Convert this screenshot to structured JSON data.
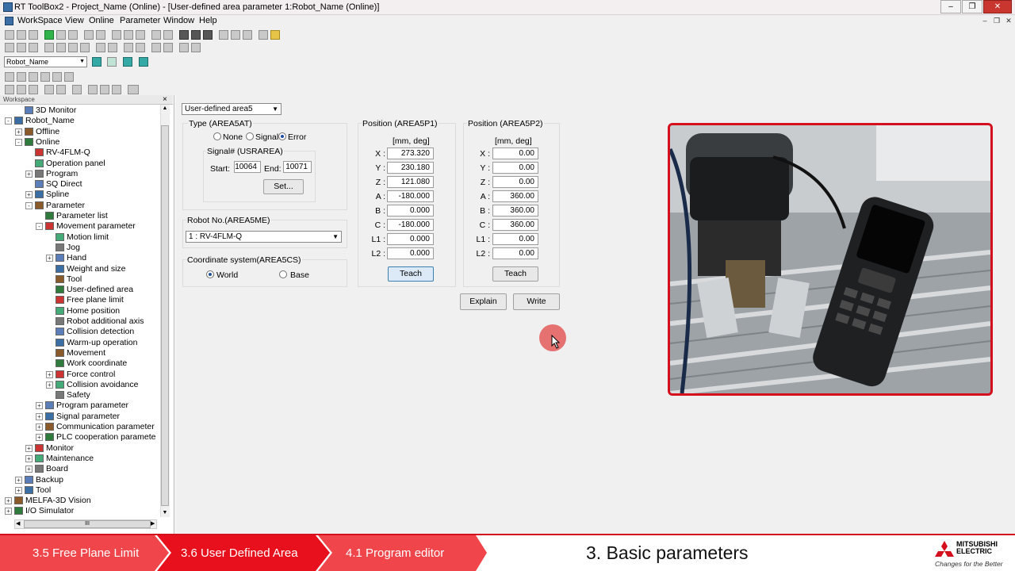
{
  "window": {
    "title": "RT ToolBox2 - Project_Name  (Online) - [User-defined area parameter 1:Robot_Name (Online)]",
    "controls": [
      "–",
      "❐",
      "✕"
    ]
  },
  "menu": [
    "WorkSpace",
    "View",
    "Online",
    "Parameter",
    "Window",
    "Help"
  ],
  "toolbar": {
    "robot_select": "Robot_Name"
  },
  "workspace": {
    "header": "Workspace",
    "tree": [
      {
        "label": "3D Monitor",
        "level": 2,
        "exp": ""
      },
      {
        "label": "Robot_Name",
        "level": 1,
        "exp": "-"
      },
      {
        "label": "Offline",
        "level": 2,
        "exp": "+"
      },
      {
        "label": "Online",
        "level": 2,
        "exp": "-"
      },
      {
        "label": "RV-4FLM-Q",
        "level": 3,
        "exp": ""
      },
      {
        "label": "Operation panel",
        "level": 3,
        "exp": ""
      },
      {
        "label": "Program",
        "level": 3,
        "exp": "+"
      },
      {
        "label": "SQ Direct",
        "level": 3,
        "exp": ""
      },
      {
        "label": "Spline",
        "level": 3,
        "exp": "+"
      },
      {
        "label": "Parameter",
        "level": 3,
        "exp": "-"
      },
      {
        "label": "Parameter list",
        "level": 4,
        "exp": ""
      },
      {
        "label": "Movement parameter",
        "level": 4,
        "exp": "-"
      },
      {
        "label": "Motion limit",
        "level": 5,
        "exp": ""
      },
      {
        "label": "Jog",
        "level": 5,
        "exp": ""
      },
      {
        "label": "Hand",
        "level": 5,
        "exp": "+"
      },
      {
        "label": "Weight and size",
        "level": 5,
        "exp": ""
      },
      {
        "label": "Tool",
        "level": 5,
        "exp": ""
      },
      {
        "label": "User-defined area",
        "level": 5,
        "exp": ""
      },
      {
        "label": "Free plane limit",
        "level": 5,
        "exp": ""
      },
      {
        "label": "Home position",
        "level": 5,
        "exp": ""
      },
      {
        "label": "Robot additional axis",
        "level": 5,
        "exp": ""
      },
      {
        "label": "Collision detection",
        "level": 5,
        "exp": ""
      },
      {
        "label": "Warm-up operation",
        "level": 5,
        "exp": ""
      },
      {
        "label": "Movement",
        "level": 5,
        "exp": ""
      },
      {
        "label": "Work coordinate",
        "level": 5,
        "exp": ""
      },
      {
        "label": "Force control",
        "level": 5,
        "exp": "+"
      },
      {
        "label": "Collision avoidance",
        "level": 5,
        "exp": "+"
      },
      {
        "label": "Safety",
        "level": 5,
        "exp": ""
      },
      {
        "label": "Program parameter",
        "level": 4,
        "exp": "+"
      },
      {
        "label": "Signal parameter",
        "level": 4,
        "exp": "+"
      },
      {
        "label": "Communication parameter",
        "level": 4,
        "exp": "+"
      },
      {
        "label": "PLC cooperation paramete",
        "level": 4,
        "exp": "+"
      },
      {
        "label": "Monitor",
        "level": 3,
        "exp": "+"
      },
      {
        "label": "Maintenance",
        "level": 3,
        "exp": "+"
      },
      {
        "label": "Board",
        "level": 3,
        "exp": "+"
      },
      {
        "label": "Backup",
        "level": 2,
        "exp": "+"
      },
      {
        "label": "Tool",
        "level": 2,
        "exp": "+"
      },
      {
        "label": "MELFA-3D Vision",
        "level": 1,
        "exp": "+"
      },
      {
        "label": "I/O Simulator",
        "level": 1,
        "exp": "+"
      }
    ],
    "hscroll_label": "III"
  },
  "area": {
    "area_select": "User-defined area5",
    "type_title": "Type (AREA5AT)",
    "type_options": [
      "None",
      "Signal",
      "Error"
    ],
    "type_selected": "Error",
    "signal_title": "Signal# (USRAREA)",
    "start_label": "Start:",
    "start_value": "10064",
    "end_label": "End:",
    "end_value": "10071",
    "set_button": "Set...",
    "robot_title": "Robot No.(AREA5ME)",
    "robot_value": "1 : RV-4FLM-Q",
    "coord_title": "Coordinate system(AREA5CS)",
    "coord_options": [
      "World",
      "Base"
    ],
    "coord_selected": "World",
    "p1_title": "Position (AREA5P1)",
    "p2_title": "Position (AREA5P2)",
    "unit": "[mm, deg]",
    "axes": [
      "X :",
      "Y :",
      "Z :",
      "A :",
      "B :",
      "C :",
      "L1 :",
      "L2 :"
    ],
    "p1_values": [
      "273.320",
      "230.180",
      "121.080",
      "-180.000",
      "0.000",
      "-180.000",
      "0.000",
      "0.000"
    ],
    "p2_values": [
      "0.00",
      "0.00",
      "0.00",
      "360.00",
      "360.00",
      "360.00",
      "0.00",
      "0.00"
    ],
    "teach_label": "Teach",
    "explain_label": "Explain",
    "write_label": "Write"
  },
  "banner": {
    "steps": [
      "3.5 Free Plane Limit",
      "3.6 User Defined Area",
      "4.1 Program editor"
    ],
    "section_title": "3. Basic parameters",
    "brand_name_1": "MITSUBISHI",
    "brand_name_2": "ELECTRIC",
    "brand_tagline": "Changes for the Better"
  },
  "colors": {
    "accent": "#d5101e",
    "step_active": "#e8101c",
    "step_inactive": "#f0454a"
  }
}
